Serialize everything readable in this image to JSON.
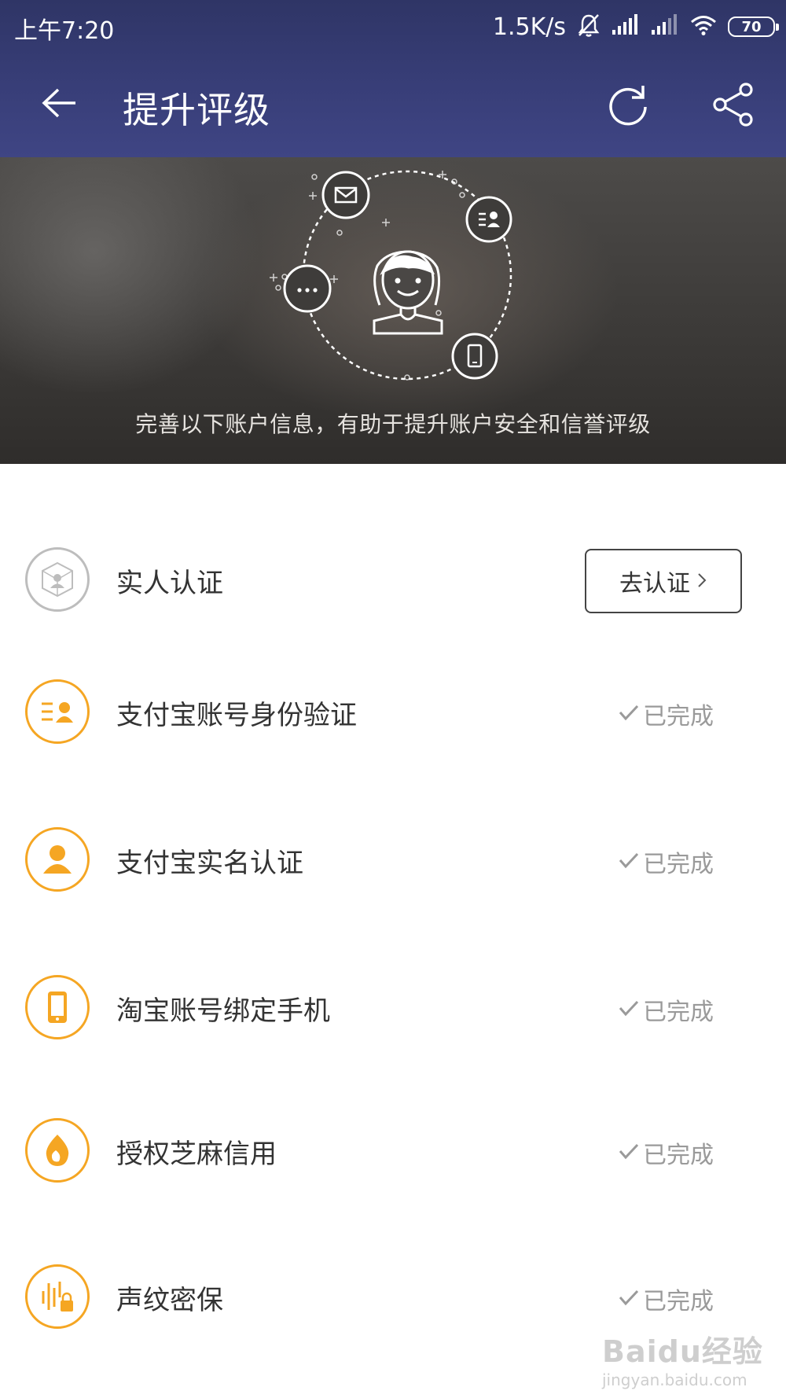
{
  "status_bar": {
    "time": "上午7:20",
    "net_speed": "1.5K/s",
    "battery": "70"
  },
  "header": {
    "title": "提升评级",
    "back_icon": "back-arrow-icon",
    "refresh_icon": "refresh-icon",
    "share_icon": "share-icon"
  },
  "banner": {
    "caption": "完善以下账户信息，有助于提升账户安全和信誉评级"
  },
  "items": [
    {
      "label": "实人认证",
      "icon": "face-verify-icon",
      "action": "去认证",
      "status": ""
    },
    {
      "label": "支付宝账号身份验证",
      "icon": "id-card-icon",
      "status": "已完成"
    },
    {
      "label": "支付宝实名认证",
      "icon": "person-icon",
      "status": "已完成"
    },
    {
      "label": "淘宝账号绑定手机",
      "icon": "phone-icon",
      "status": "已完成"
    },
    {
      "label": "授权芝麻信用",
      "icon": "sesame-icon",
      "status": "已完成"
    },
    {
      "label": "声纹密保",
      "icon": "voiceprint-icon",
      "status": "已完成"
    }
  ],
  "colors": {
    "header_bg": "#383e78",
    "accent": "#f5a623",
    "done_text": "#9a9a9a"
  },
  "watermark": {
    "main": "Baidu经验",
    "sub": "jingyan.baidu.com"
  }
}
